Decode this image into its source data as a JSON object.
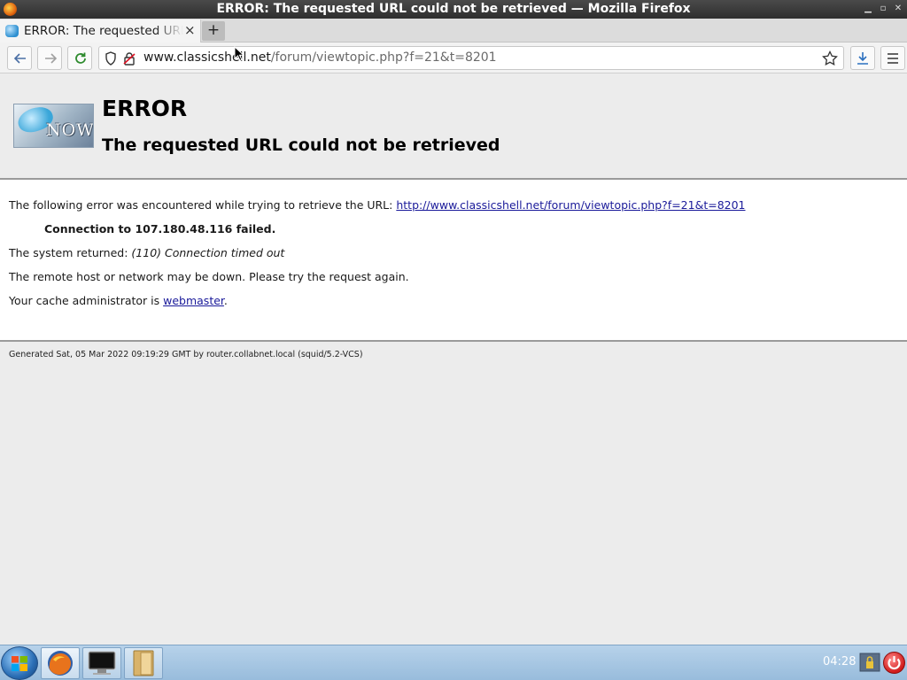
{
  "window": {
    "title": "ERROR: The requested URL could not be retrieved — Mozilla Firefox"
  },
  "tabs": [
    {
      "title": "ERROR: The requested URL could not be retrieved",
      "active": true
    }
  ],
  "urlbar": {
    "host": "www.classicshell.net",
    "path": "/forum/viewtopic.php?f=21&t=8201"
  },
  "page": {
    "heading": "ERROR",
    "subheading": "The requested URL could not be retrieved",
    "error_intro": "The following error was encountered while trying to retrieve the URL: ",
    "error_url": "http://www.classicshell.net/forum/viewtopic.php?f=21&t=8201",
    "connection_failed": "Connection to 107.180.48.116 failed.",
    "system_returned_label": "The system returned: ",
    "system_returned_value": "(110) Connection timed out",
    "remote_down": "The remote host or network may be down. Please try the request again.",
    "cache_admin_prefix": "Your cache administrator is ",
    "cache_admin_link": "webmaster",
    "cache_admin_suffix": ".",
    "footer": "Generated Sat, 05 Mar 2022 09:19:29 GMT by router.collabnet.local (squid/5.2-VCS)",
    "logo_text": "NOW"
  },
  "taskbar": {
    "clock": "04:28",
    "items": [
      "firefox-icon",
      "terminal-icon",
      "file-manager-icon"
    ]
  },
  "colors": {
    "link": "#1a1a9a",
    "titlebar": "#3a3a3a",
    "taskbar": "#a9c8e4"
  }
}
